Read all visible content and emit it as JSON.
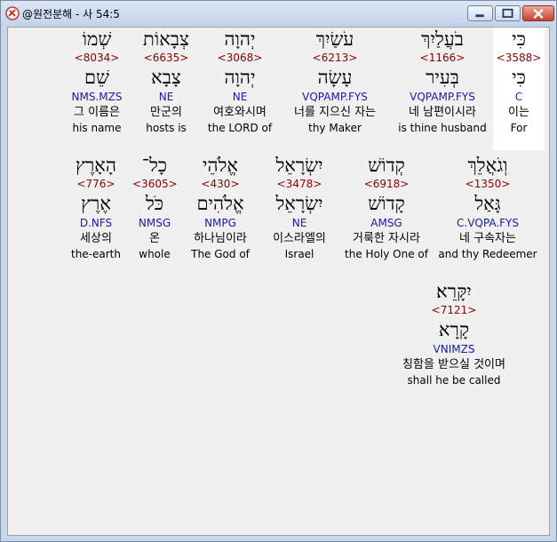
{
  "window": {
    "title": "@원전분해 - 사 54:5",
    "buttons": [
      "minimize",
      "maximize",
      "close"
    ]
  },
  "words": [
    {
      "heb": "כִּי",
      "num": "<3588>",
      "heb2": "כִּי",
      "pars": "C",
      "kor": "이는",
      "eng": "For"
    },
    {
      "heb": "בֹעֲלַיִךְ",
      "num": "<1166>",
      "heb2": "בְּעִיר",
      "pars": "VQPAMP.FYS",
      "kor": "네 남편이시라",
      "eng": "is thine husband"
    },
    {
      "heb": "עֹשַׂיִךְ",
      "num": "<6213>",
      "heb2": "עָשָׂה",
      "pars": "VQPAMP.FYS",
      "kor": "너를 지으신 자는",
      "eng": "thy Maker"
    },
    {
      "heb": "יְהוָה",
      "num": "<3068>",
      "heb2": "יְהוָה",
      "pars": "NE",
      "kor": "여호와시며",
      "eng": "the LORD of"
    },
    {
      "heb": "צְבָאוֹת",
      "num": "<6635>",
      "heb2": "צָבָא",
      "pars": "NE",
      "kor": "만군의",
      "eng": "hosts is"
    },
    {
      "heb": "שְׁמוֹ",
      "num": "<8034>",
      "heb2": "שֵׁם",
      "pars": "NMS.MZS",
      "kor": "그 이름은",
      "eng": "his name"
    },
    {
      "heb": "וְגֹאֲלֵךְ",
      "num": "<1350>",
      "heb2": "גָּאַל",
      "pars": "C.VQPA.FYS",
      "kor": "네 구속자는",
      "eng": "and thy Redeemer"
    },
    {
      "heb": "קְדוֹשׁ",
      "num": "<6918>",
      "heb2": "קָדוֹשׁ",
      "pars": "AMSG",
      "kor": "거룩한 자시라",
      "eng": "the Holy One of"
    },
    {
      "heb": "יִשְׂרָאֵל",
      "num": "<3478>",
      "heb2": "יִשְׂרָאֵל",
      "pars": "NE",
      "kor": "이스라엘의",
      "eng": "Israel"
    },
    {
      "heb": "אֱלֹהֵי",
      "num": "<430>",
      "heb2": "אֱלֹהִים",
      "pars": "NMPG",
      "kor": "하나님이라",
      "eng": "The God of"
    },
    {
      "heb": "כָל־",
      "num": "<3605>",
      "heb2": "כֹּל",
      "pars": "NMSG",
      "kor": "온",
      "eng": "whole"
    },
    {
      "heb": "הָאָרֶץ",
      "num": "<776>",
      "heb2": "אֶרֶץ",
      "pars": "D.NFS",
      "kor": "세상의",
      "eng": "the-earth"
    },
    {
      "heb": "יִקָּרֵא׃",
      "num": "<7121>",
      "heb2": "קָרָא",
      "pars": "VNIMZS",
      "kor": "칭함을 받으실 것이며",
      "eng": "shall he be called"
    }
  ]
}
